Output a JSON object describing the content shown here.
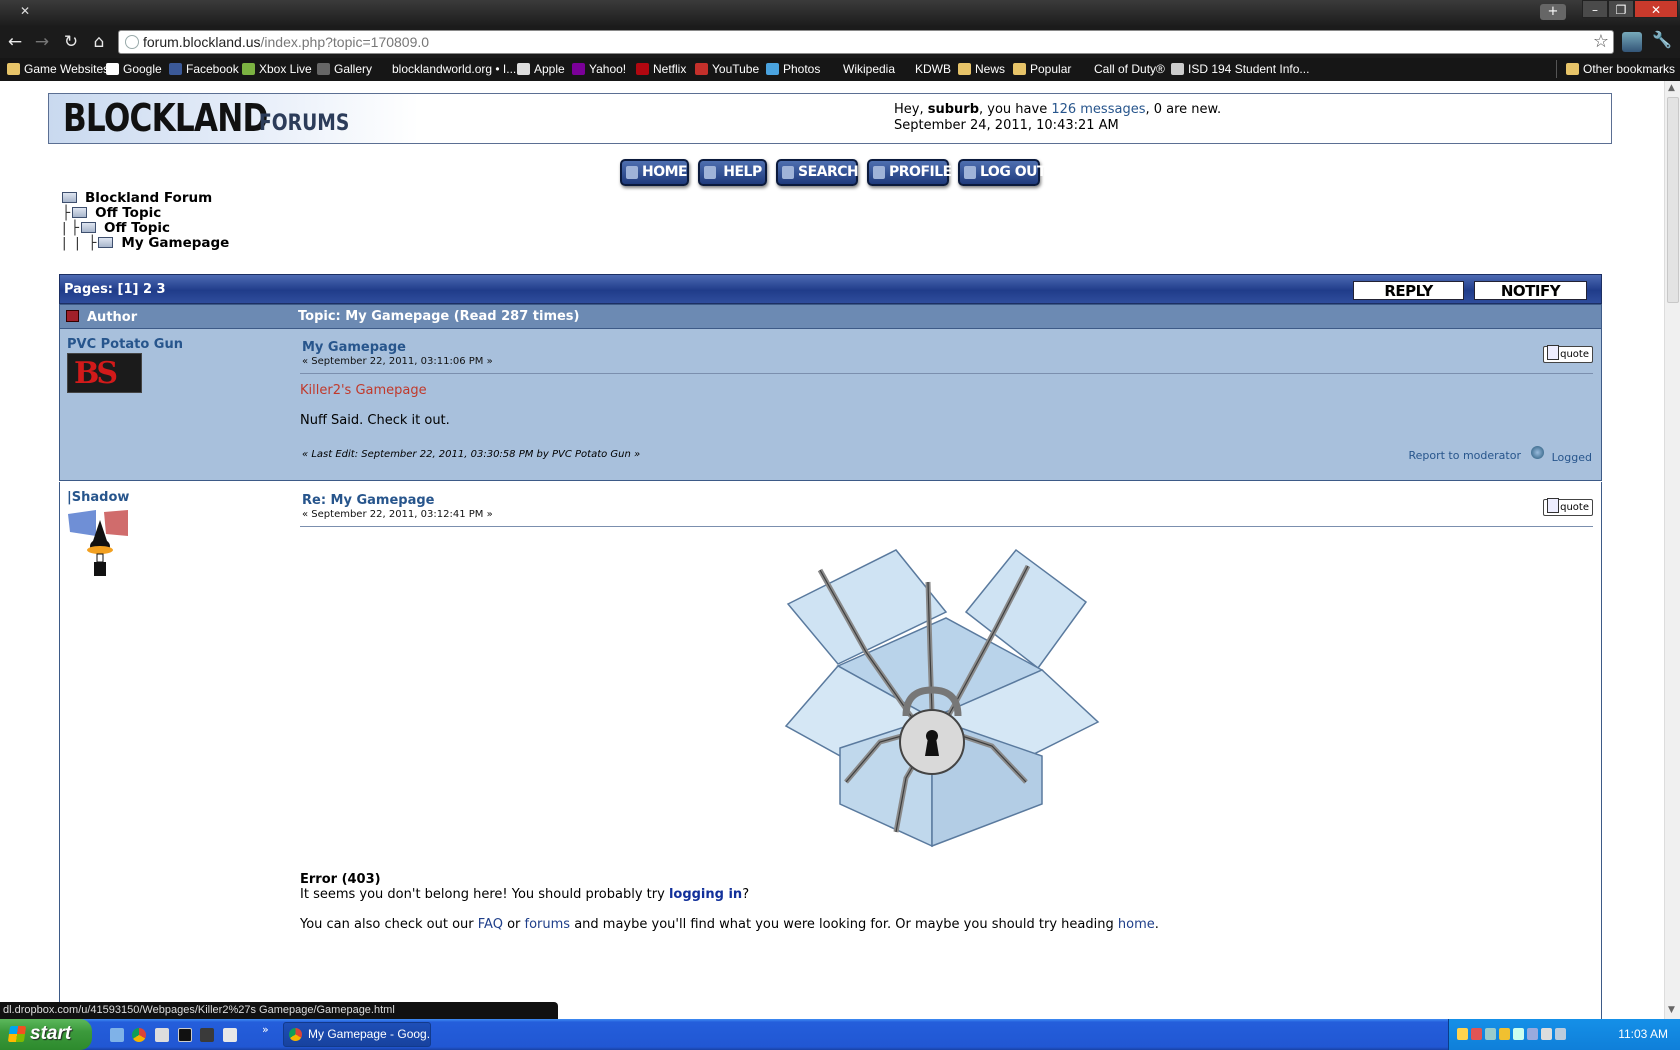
{
  "browser": {
    "url_host": "forum.blockland.us",
    "url_path": "/index.php?topic=170809.0",
    "new_tab": "+",
    "bookmarks": [
      {
        "label": "Game Websites",
        "icon": "folder-icon"
      },
      {
        "label": "Google",
        "icon": "google-icon"
      },
      {
        "label": "Facebook",
        "icon": "facebook-icon"
      },
      {
        "label": "Xbox Live",
        "icon": "xbox-icon"
      },
      {
        "label": "Gallery",
        "icon": "gallery-icon"
      },
      {
        "label": "blocklandworld.org • I...",
        "icon": "blank-page-icon"
      },
      {
        "label": "Apple",
        "icon": "apple-icon"
      },
      {
        "label": "Yahoo!",
        "icon": "yahoo-icon"
      },
      {
        "label": "Netflix",
        "icon": "netflix-icon"
      },
      {
        "label": "YouTube",
        "icon": "youtube-icon"
      },
      {
        "label": "Photos",
        "icon": "photos-icon"
      },
      {
        "label": "Wikipedia",
        "icon": "blank-page-icon"
      },
      {
        "label": "KDWB",
        "icon": "blank-page-icon"
      },
      {
        "label": "News",
        "icon": "folder-icon"
      },
      {
        "label": "Popular",
        "icon": "folder-icon"
      },
      {
        "label": "Call of Duty®",
        "icon": "blank-page-icon"
      },
      {
        "label": "ISD 194 Student Info...",
        "icon": "isd-icon"
      }
    ],
    "other_bookmarks": "Other bookmarks",
    "status_url": "dl.dropbox.com/u/41593150/Webpages/Killer2%27s Gamepage/Gamepage.html"
  },
  "forum": {
    "logo_main": "BLOCKLAND",
    "logo_sub": "FORUMS",
    "greeting": {
      "prefix": "Hey, ",
      "username": "suburb",
      "mid": ", you have ",
      "messages": "126 messages",
      "suffix": ", 0 are new.",
      "datetime": "September 24, 2011, 10:43:21 AM"
    },
    "menu": [
      "HOME",
      "HELP",
      "SEARCH",
      "PROFILE",
      "LOG OUT"
    ],
    "linktree": [
      "Blockland Forum",
      "Off Topic",
      "Off Topic",
      "My Gamepage"
    ],
    "pages_text": "Pages: [1] 2 3",
    "reply_label": "REPLY",
    "notify_label": "NOTIFY",
    "author_header": "Author",
    "topic_header": "Topic: My Gamepage  (Read 287 times)",
    "quote_label": "quote",
    "report_label": "Report to moderator",
    "logged_label": "Logged"
  },
  "posts": [
    {
      "author": "PVC Potato Gun",
      "avatar_text": "BS",
      "title": "My Gamepage",
      "date": "« September 22, 2011, 03:11:06 PM »",
      "link_text": "Killer2's Gamepage",
      "body": "Nuff Said. Check it out.",
      "last_edit": "« Last Edit: September 22, 2011, 03:30:58 PM by PVC Potato Gun »"
    },
    {
      "author": "|Shadow",
      "title": "Re: My Gamepage",
      "date": "« September 22, 2011, 03:12:41 PM »",
      "error_title": "Error (403)",
      "error_line1_a": "It seems you don't belong here! You should probably try ",
      "error_line1_link": "logging in",
      "error_line1_b": "?",
      "error_line2_a": "You can also check out our ",
      "error_line2_faq": "FAQ",
      "error_line2_b": " or ",
      "error_line2_forums": "forums",
      "error_line2_c": " and maybe you'll find what you were looking for. Or maybe you should try heading ",
      "error_line2_home": "home",
      "error_line2_d": "."
    }
  ],
  "taskbar": {
    "start": "start",
    "task_label": "My Gamepage - Goog...",
    "clock": "11:03 AM"
  }
}
